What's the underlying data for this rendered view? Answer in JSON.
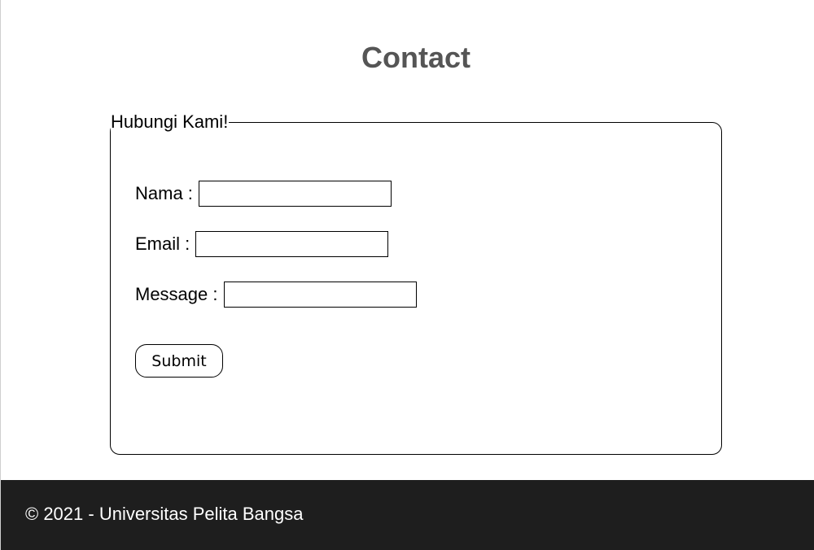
{
  "page": {
    "title": "Contact"
  },
  "form": {
    "legend": "Hubungi Kami!",
    "fields": [
      {
        "label": "Nama :",
        "value": ""
      },
      {
        "label": "Email :",
        "value": ""
      },
      {
        "label": "Message :",
        "value": ""
      }
    ],
    "submit_label": "Submit"
  },
  "footer": {
    "copyright": "© 2021 - Universitas Pelita Bangsa"
  },
  "colors": {
    "title": "#555555",
    "footer_bg": "#1e1e1e",
    "footer_text": "#ffffff"
  }
}
